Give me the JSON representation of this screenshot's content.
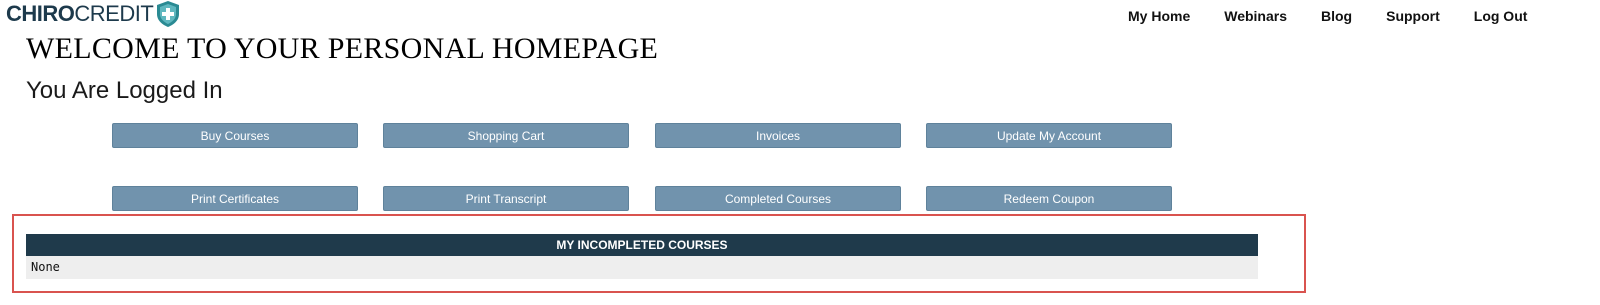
{
  "logo": {
    "part1": "CHIRO",
    "part2": "CREDIT",
    "icon": "shield-cross-icon"
  },
  "nav": {
    "items": [
      {
        "label": "My Home"
      },
      {
        "label": "Webinars"
      },
      {
        "label": "Blog"
      },
      {
        "label": "Support"
      },
      {
        "label": "Log Out"
      }
    ]
  },
  "page": {
    "title": "WELCOME TO YOUR PERSONAL HOMEPAGE",
    "subtitle": "You Are Logged In"
  },
  "actions": {
    "row1": [
      {
        "label": "Buy Courses"
      },
      {
        "label": "Shopping Cart"
      },
      {
        "label": "Invoices"
      },
      {
        "label": "Update My Account"
      }
    ],
    "row2": [
      {
        "label": "Print Certificates"
      },
      {
        "label": "Print Transcript"
      },
      {
        "label": "Completed Courses"
      },
      {
        "label": "Redeem Coupon"
      }
    ]
  },
  "incomplete_courses": {
    "header": "MY INCOMPLETED COURSES",
    "rows": [
      "None"
    ]
  },
  "colors": {
    "brand_dark": "#1f3a4b",
    "button": "#7193ad",
    "highlight": "#d9534f",
    "logo_teal": "#2a8a93"
  }
}
